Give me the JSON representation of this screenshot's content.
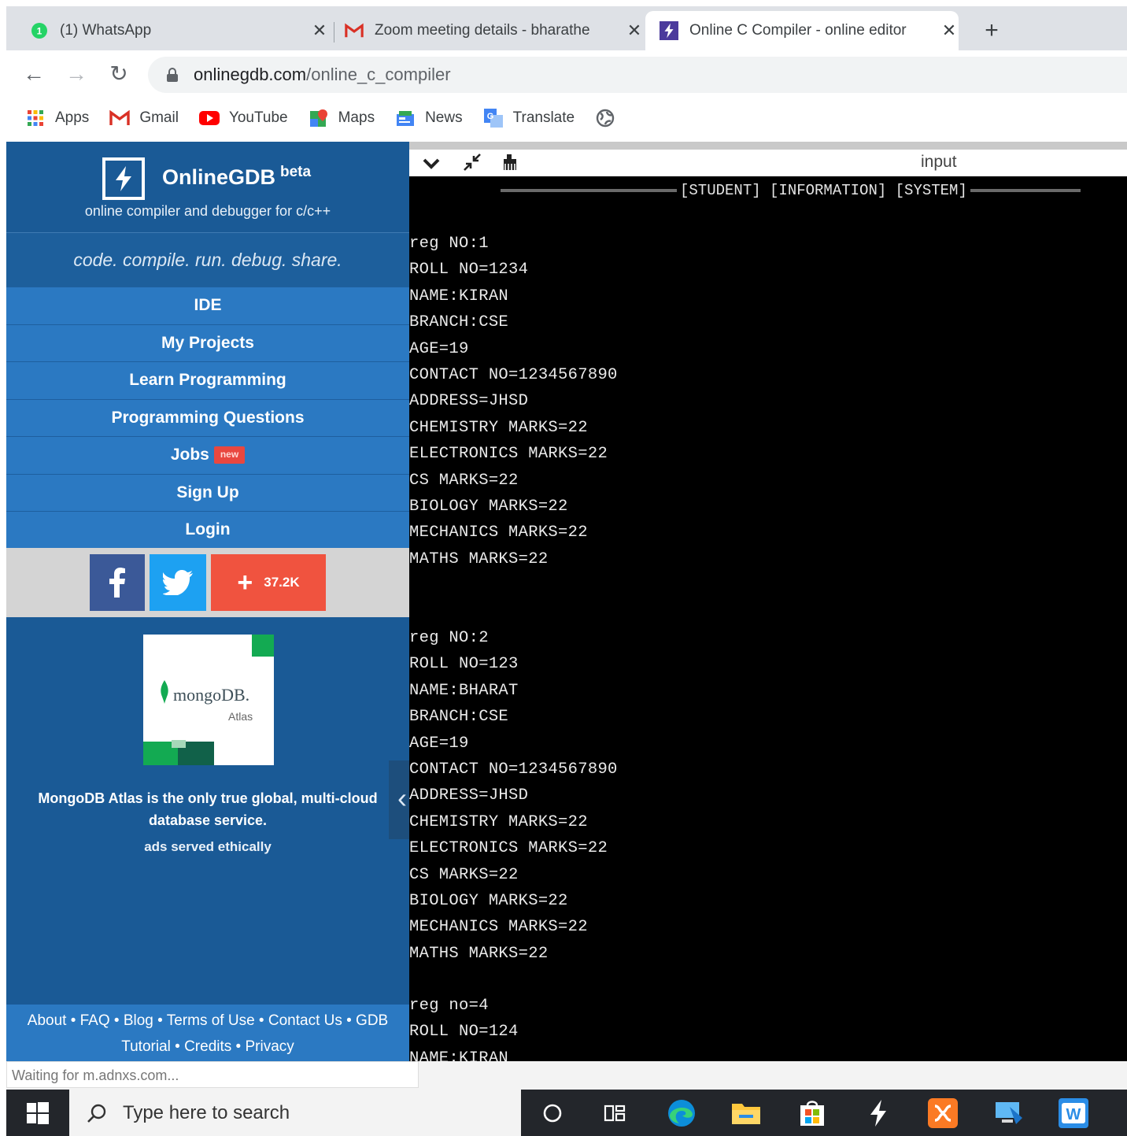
{
  "browser": {
    "tabs": [
      {
        "title": "(1) WhatsApp",
        "icon": "whatsapp-icon"
      },
      {
        "title": "Zoom meeting details - bharathe",
        "icon": "gmail-icon"
      },
      {
        "title": "Online C Compiler - online editor",
        "icon": "onlinegdb-icon",
        "active": true
      }
    ],
    "url_domain": "onlinegdb.com",
    "url_path": "/online_c_compiler",
    "bookmarks": [
      {
        "label": "Apps",
        "icon": "apps-grid-icon"
      },
      {
        "label": "Gmail",
        "icon": "gmail-icon"
      },
      {
        "label": "YouTube",
        "icon": "youtube-icon"
      },
      {
        "label": "Maps",
        "icon": "maps-icon"
      },
      {
        "label": "News",
        "icon": "news-icon"
      },
      {
        "label": "Translate",
        "icon": "translate-icon"
      }
    ]
  },
  "sidebar": {
    "brand": "OnlineGDB",
    "beta": "beta",
    "subtitle": "online compiler and debugger for c/c++",
    "tagline": "code. compile. run. debug. share.",
    "menu": [
      {
        "label": "IDE"
      },
      {
        "label": "My Projects"
      },
      {
        "label": "Learn Programming"
      },
      {
        "label": "Programming Questions"
      },
      {
        "label": "Jobs",
        "badge": "new"
      },
      {
        "label": "Sign Up"
      },
      {
        "label": "Login"
      }
    ],
    "share_count": "37.2K",
    "ad_logo_text": "mongoDB.",
    "ad_logo_sub": "Atlas",
    "ad_text": "MongoDB Atlas is the only true global, multi-cloud database service.",
    "ad_credit": "ads served ethically",
    "footer_line1": "About • FAQ • Blog • Terms of Use • Contact Us • GDB",
    "footer_line2": "Tutorial • Credits • Privacy"
  },
  "console": {
    "input_label": "input",
    "banner": "[STUDENT] [INFORMATION] [SYSTEM]",
    "lines": [
      "reg NO:1",
      "ROLL NO=1234",
      "NAME:KIRAN",
      "BRANCH:CSE",
      "AGE=19",
      "CONTACT NO=1234567890",
      "ADDRESS=JHSD",
      "CHEMISTRY MARKS=22",
      "ELECTRONICS MARKS=22",
      "CS MARKS=22",
      "BIOLOGY MARKS=22",
      "MECHANICS MARKS=22",
      "MATHS MARKS=22",
      "reg NO:2",
      "ROLL NO=123",
      "NAME:BHARAT",
      "BRANCH:CSE",
      "AGE=19",
      "CONTACT NO=1234567890",
      "ADDRESS=JHSD",
      "CHEMISTRY MARKS=22",
      "ELECTRONICS MARKS=22",
      "CS MARKS=22",
      "BIOLOGY MARKS=22",
      "MECHANICS MARKS=22",
      "MATHS MARKS=22",
      "reg no=4",
      "ROLL NO=124",
      "NAME:KIRAN"
    ]
  },
  "status": "Waiting for m.adnxs.com...",
  "taskbar": {
    "search_placeholder": "Type here to search"
  }
}
